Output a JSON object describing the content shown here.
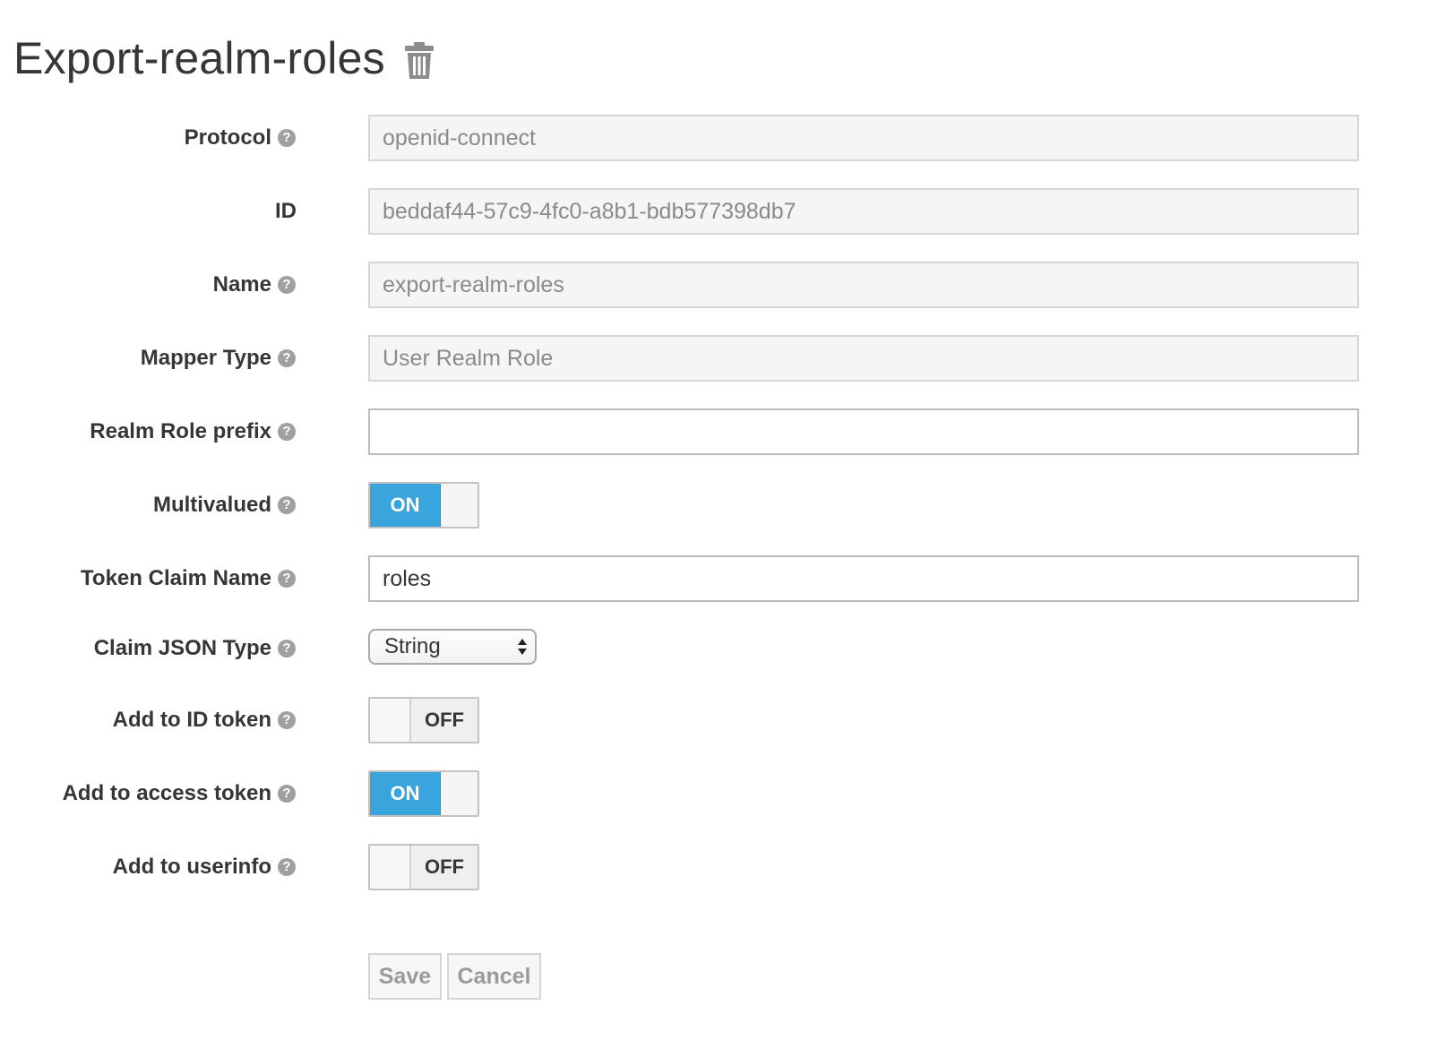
{
  "page": {
    "title": "Export-realm-roles"
  },
  "form": {
    "protocol": {
      "label": "Protocol",
      "value": "openid-connect"
    },
    "id": {
      "label": "ID",
      "value": "beddaf44-57c9-4fc0-a8b1-bdb577398db7"
    },
    "name": {
      "label": "Name",
      "value": "export-realm-roles"
    },
    "mapper_type": {
      "label": "Mapper Type",
      "value": "User Realm Role"
    },
    "realm_role_prefix": {
      "label": "Realm Role prefix",
      "value": ""
    },
    "multivalued": {
      "label": "Multivalued",
      "state": "ON"
    },
    "token_claim_name": {
      "label": "Token Claim Name",
      "value": "roles"
    },
    "claim_json_type": {
      "label": "Claim JSON Type",
      "selected": "String"
    },
    "add_to_id_token": {
      "label": "Add to ID token",
      "state": "OFF"
    },
    "add_to_access_token": {
      "label": "Add to access token",
      "state": "ON"
    },
    "add_to_userinfo": {
      "label": "Add to userinfo",
      "state": "OFF"
    }
  },
  "buttons": {
    "save": "Save",
    "cancel": "Cancel"
  },
  "icons": {
    "help": "question-circle-icon",
    "delete": "trash-icon"
  },
  "colors": {
    "switch_on": "#39a5dc",
    "text": "#363636"
  }
}
